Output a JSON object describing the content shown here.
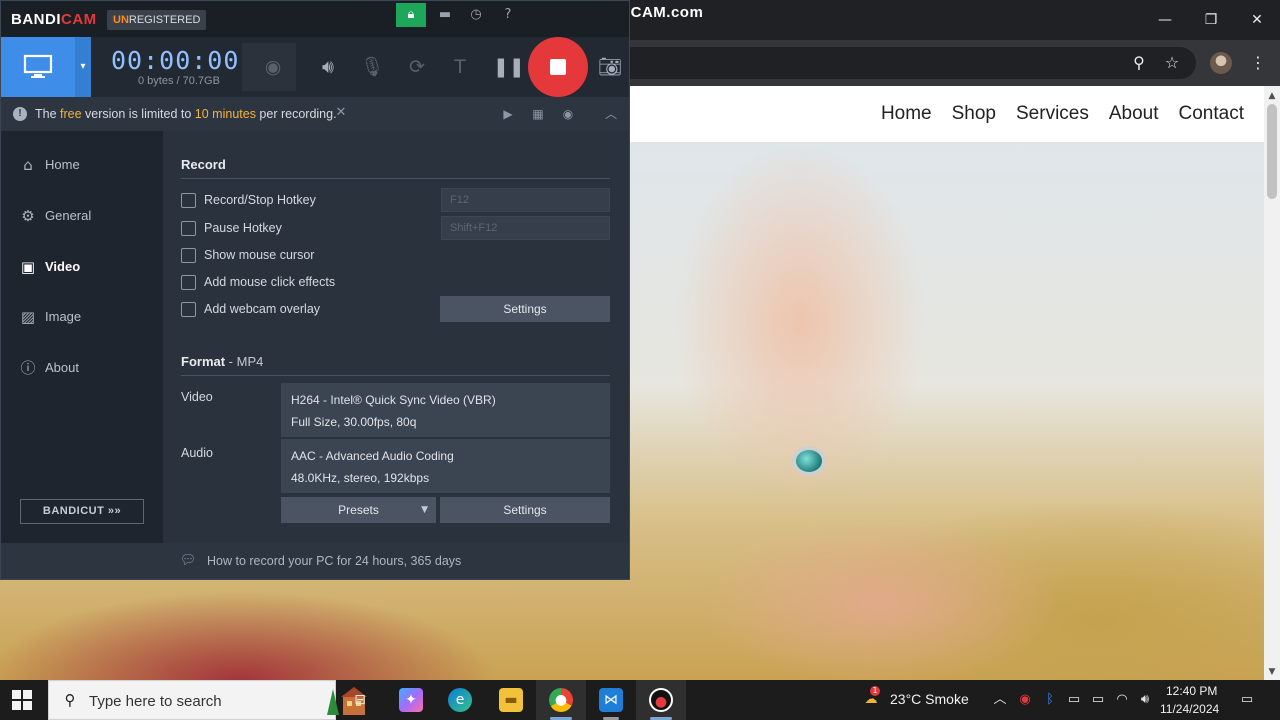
{
  "watermark": "www.BANDICAM.com",
  "browser": {
    "nav": [
      "Home",
      "Shop",
      "Services",
      "About",
      "Contact"
    ],
    "window_controls": {
      "minimize": "—",
      "restore": "❐",
      "close": "✕"
    }
  },
  "bandicam": {
    "brand_bandi": "BANDI",
    "brand_cam": "CAM",
    "unregistered_un": "UN",
    "unregistered_rest": "REGISTERED",
    "timer": "00:00:00",
    "bytes": "0 bytes / 70.7GB",
    "notice": {
      "prefix": "The ",
      "free": "free",
      "middle": " version is limited to ",
      "minutes": "10 minutes",
      "suffix": " per recording."
    },
    "sidebar": {
      "items": [
        {
          "label": "Home",
          "icon": "home-icon"
        },
        {
          "label": "General",
          "icon": "gear-icon"
        },
        {
          "label": "Video",
          "icon": "video-settings-icon"
        },
        {
          "label": "Image",
          "icon": "image-icon"
        },
        {
          "label": "About",
          "icon": "info-icon"
        }
      ],
      "bandicut": "BANDICUT »»"
    },
    "record": {
      "title": "Record",
      "options": [
        "Record/Stop Hotkey",
        "Pause Hotkey",
        "Show mouse cursor",
        "Add mouse click effects",
        "Add webcam overlay"
      ],
      "hotkey_record": "F12",
      "hotkey_pause": "Shift+F12",
      "settings_label": "Settings"
    },
    "format": {
      "title": "Format",
      "container": " - MP4",
      "video_label": "Video",
      "video_line1": "H264 - Intel® Quick Sync Video (VBR)",
      "video_line2": "Full Size, 30.00fps, 80q",
      "audio_label": "Audio",
      "audio_line1": "AAC - Advanced Audio Coding",
      "audio_line2": "48.0KHz, stereo, 192kbps",
      "presets_label": "Presets",
      "settings_label": "Settings"
    },
    "footer": "How to record your PC for 24 hours, 365 days"
  },
  "taskbar": {
    "search_placeholder": "Type here to search",
    "weather": "23°C  Smoke",
    "time": "12:40 PM",
    "date": "11/24/2024",
    "weather_badge": "1"
  },
  "colors": {
    "bandicam_accent": "#3e8ee9",
    "record_red": "#e5383b",
    "highlight_orange": "#f2b33d"
  }
}
